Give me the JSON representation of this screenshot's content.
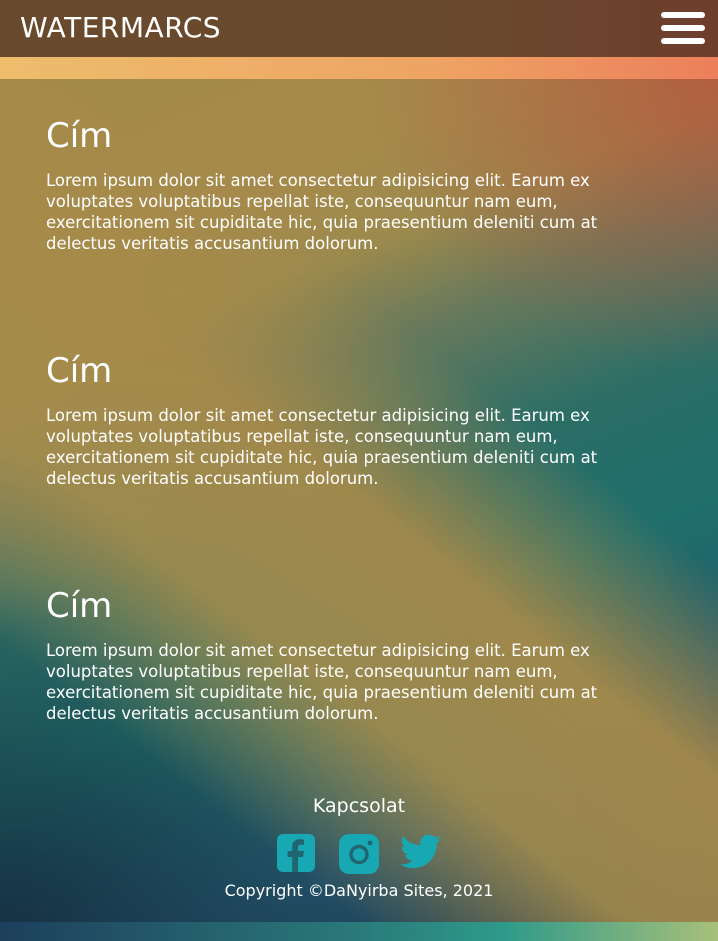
{
  "header": {
    "logo": "WATERMARCS",
    "menu_icon": "hamburger-menu-icon"
  },
  "sections": [
    {
      "title": "Cím",
      "text": "Lorem ipsum dolor sit amet consectetur adipisicing elit. Earum ex voluptates voluptatibus repellat iste, consequuntur nam eum, exercitationem sit cupiditate hic, quia praesentium deleniti cum at delectus veritatis accusantium dolorum."
    },
    {
      "title": "Cím",
      "text": "Lorem ipsum dolor sit amet consectetur adipisicing elit. Earum ex voluptates voluptatibus repellat iste, consequuntur nam eum, exercitationem sit cupiditate hic, quia praesentium deleniti cum at delectus veritatis accusantium dolorum."
    },
    {
      "title": "Cím",
      "text": "Lorem ipsum dolor sit amet consectetur adipisicing elit. Earum ex voluptates voluptatibus repellat iste, consequuntur nam eum, exercitationem sit cupiditate hic, quia praesentium deleniti cum at delectus veritatis accusantium dolorum."
    }
  ],
  "footer": {
    "title": "Kapcsolat",
    "social_icons": [
      "facebook-icon",
      "instagram-icon",
      "twitter-icon"
    ],
    "copyright": "Copyright ©DaNyirba Sites, 2021"
  },
  "colors": {
    "header_bg": "#6a4a2c",
    "accent_bar": "#eea464",
    "social_icon": "#17a8b4",
    "text": "#ffffff"
  }
}
